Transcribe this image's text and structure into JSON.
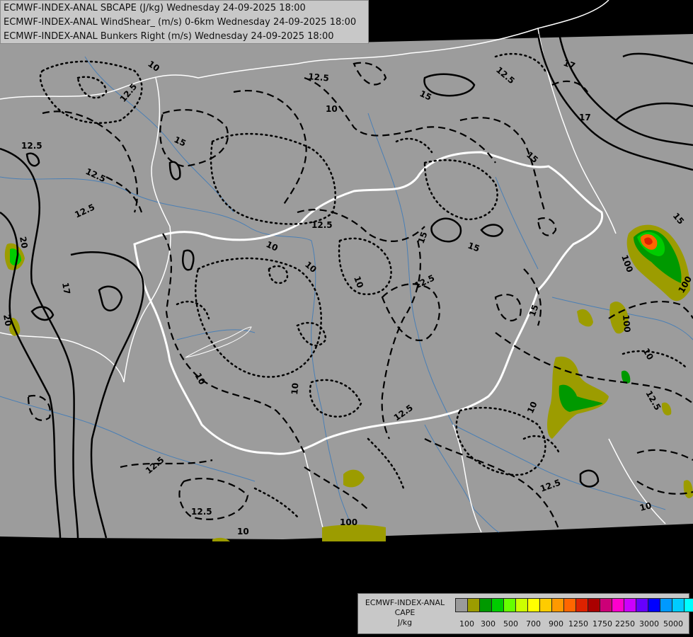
{
  "titles": [
    "ECMWF-INDEX-ANAL SBCAPE (J/kg) Wednesday 24-09-2025 18:00",
    "ECMWF-INDEX-ANAL WindShear_ (m/s) 0-6km Wednesday 24-09-2025 18:00",
    "ECMWF-INDEX-ANAL Bunkers Right (m/s) Wednesday 24-09-2025 18:00"
  ],
  "legend": {
    "title_line1": "ECMWF-INDEX-ANAL",
    "title_line2": "CAPE",
    "unit": "J/kg",
    "colors": [
      "#9a9a9a",
      "#9c9c00",
      "#009900",
      "#00cc00",
      "#66ff00",
      "#ccff00",
      "#ffff00",
      "#ffcc00",
      "#ff9900",
      "#ff6600",
      "#dd2200",
      "#aa0000",
      "#cc0077",
      "#ff00cc",
      "#cc00ff",
      "#6600ff",
      "#0000ff",
      "#0099ff",
      "#00ccff",
      "#00ffff",
      "#ffffff"
    ],
    "labels": [
      "100",
      "300",
      "500",
      "700",
      "900",
      "1250",
      "1750",
      "2250",
      "3000",
      "5000"
    ]
  },
  "contour_labels": {
    "windshear": [
      "10",
      "12.5",
      "12.5",
      "12.5",
      "12.5",
      "15",
      "15",
      "15",
      "15",
      "17",
      "17",
      "20",
      "20",
      "17",
      "12.5",
      "10",
      "10",
      "10",
      "12.5",
      "15",
      "12.5",
      "15",
      "15",
      "10",
      "10",
      "12.5",
      "12.5",
      "12.5",
      "12.5",
      "10",
      "10",
      "10",
      "12.5",
      "10",
      "12.5",
      "10"
    ],
    "cape": [
      "100",
      "100",
      "100",
      "100"
    ]
  },
  "colors": {
    "background": "#000000",
    "domain": "#9c9c9c",
    "contour": "#000000",
    "border": "#ffffff",
    "river": "#4a7fb5"
  }
}
